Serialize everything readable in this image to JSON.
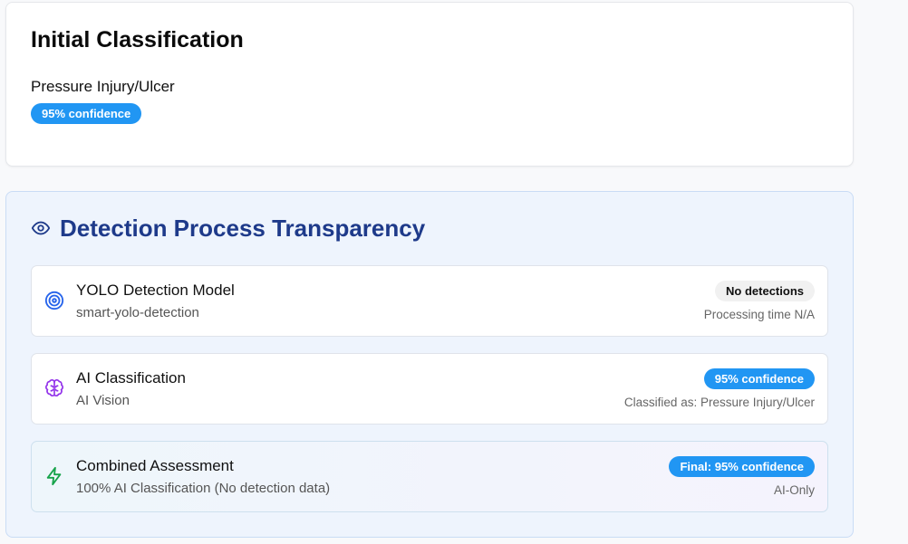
{
  "initial": {
    "title": "Initial Classification",
    "label": "Pressure Injury/Ulcer",
    "confidence": "95% confidence"
  },
  "transparency": {
    "title": "Detection Process Transparency",
    "rows": [
      {
        "title": "YOLO Detection Model",
        "sub": "smart-yolo-detection",
        "badge": "No detections",
        "note": "Processing time N/A",
        "icon": "target-icon"
      },
      {
        "title": "AI Classification",
        "sub": "AI Vision",
        "badge": "95% confidence",
        "note": "Classified as: Pressure Injury/Ulcer",
        "icon": "brain-icon"
      },
      {
        "title": "Combined Assessment",
        "sub": "100% AI Classification (No detection data)",
        "badge": "Final: 95% confidence",
        "note": "AI-Only",
        "icon": "lightning-icon"
      }
    ]
  },
  "colors": {
    "accent_blue": "#2196f3",
    "heading_navy": "#1e3a8a",
    "panel_bg": "#eef4fd"
  }
}
